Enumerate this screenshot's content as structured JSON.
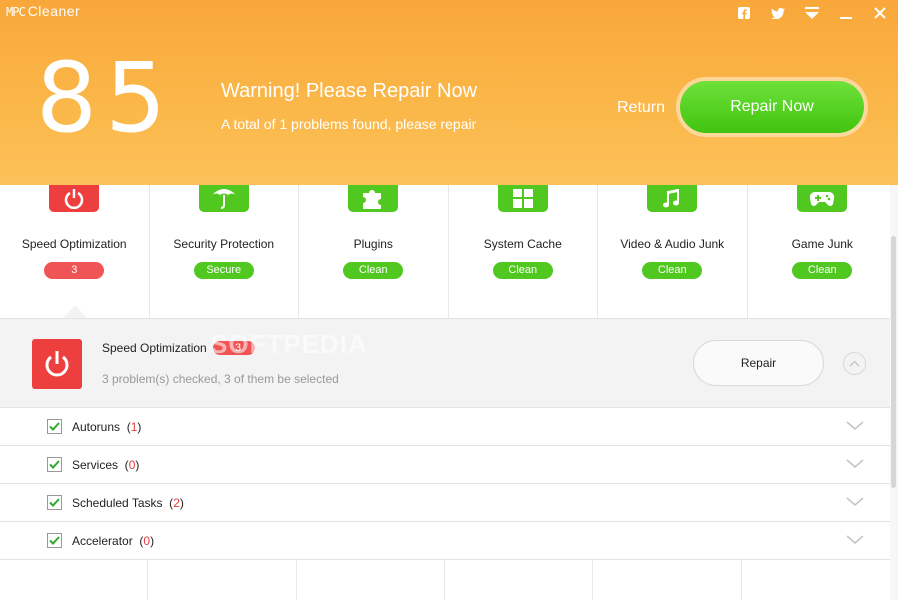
{
  "app": {
    "title": "Cleaner",
    "logo_mark": "MPC"
  },
  "titlebar": {
    "icons": [
      "facebook-icon",
      "twitter-icon",
      "menu-icon",
      "minimize-icon",
      "close-icon"
    ]
  },
  "header": {
    "score": "85",
    "warning_title": "Warning! Please Repair Now",
    "warning_subtitle": "A total of 1 problems found, please repair",
    "return_label": "Return",
    "repair_now_label": "Repair Now",
    "colors": {
      "accent": "#f9a73a",
      "green": "#50c81f",
      "red": "#ee3f3f"
    }
  },
  "categories": [
    {
      "label": "Speed Optimization",
      "badge": "3",
      "status": "problem",
      "icon": "power-icon"
    },
    {
      "label": "Security Protection",
      "badge": "Secure",
      "status": "ok",
      "icon": "umbrella-icon"
    },
    {
      "label": "Plugins",
      "badge": "Clean",
      "status": "ok",
      "icon": "puzzle-icon"
    },
    {
      "label": "System Cache",
      "badge": "Clean",
      "status": "ok",
      "icon": "windows-icon"
    },
    {
      "label": "Video & Audio Junk",
      "badge": "Clean",
      "status": "ok",
      "icon": "music-icon"
    },
    {
      "label": "Game Junk",
      "badge": "Clean",
      "status": "ok",
      "icon": "gamepad-icon"
    }
  ],
  "detail": {
    "title": "Speed Optimization",
    "count": "3",
    "subtitle": "3 problem(s) checked, 3 of them be selected",
    "repair_label": "Repair",
    "watermark": "SOFTPEDIA"
  },
  "items": [
    {
      "label": "Autoruns",
      "count": "1",
      "checked": true
    },
    {
      "label": "Services",
      "count": "0",
      "checked": true
    },
    {
      "label": "Scheduled Tasks",
      "count": "2",
      "checked": true
    },
    {
      "label": "Accelerator",
      "count": "0",
      "checked": true
    }
  ]
}
